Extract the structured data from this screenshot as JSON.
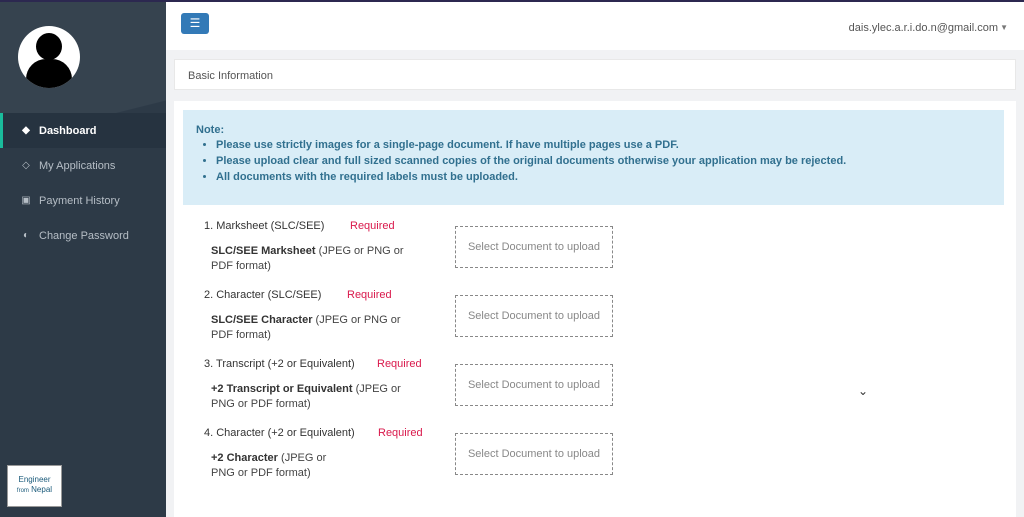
{
  "user": {
    "email": "dais.ylec.a.r.i.do.n@gmail.com"
  },
  "sidebar": {
    "items": [
      {
        "label": "Dashboard",
        "icon": "diamond-icon",
        "glyph": "◆",
        "active": true
      },
      {
        "label": "My Applications",
        "icon": "diamond-outline-icon",
        "glyph": "◇",
        "active": false
      },
      {
        "label": "Payment History",
        "icon": "money-icon",
        "glyph": "▣",
        "active": false
      },
      {
        "label": "Change Password",
        "icon": "toggle-icon",
        "glyph": "◐",
        "active": false
      }
    ],
    "logo_line1": "Engineer",
    "logo_line2": "from",
    "logo_line3": "Nepal"
  },
  "section_title": "Basic Information",
  "note": {
    "heading": "Note:",
    "items": [
      "Please use strictly images for a single-page document. If have multiple pages use a PDF.",
      "Please upload clear and full sized scanned copies of the original documents otherwise your application may be rejected.",
      "All documents with the required labels must be uploaded."
    ]
  },
  "documents": [
    {
      "title": "1. Marksheet (SLC/SEE)",
      "required": "Required",
      "desc_bold": "SLC/SEE Marksheet",
      "desc_rest": " (JPEG or PNG or PDF format)",
      "upload": "Select Document to upload"
    },
    {
      "title": "2. Character (SLC/SEE)",
      "required": "Required",
      "desc_bold": "SLC/SEE Character",
      "desc_rest": " (JPEG or PNG or PDF format)",
      "upload": "Select Document to upload"
    },
    {
      "title": "3. Transcript (+2 or Equivalent)",
      "required": "Required",
      "desc_bold": "+2 Transcript or Equivalent",
      "desc_rest": " (JPEG or PNG or PDF format)",
      "upload": "Select Document to upload"
    },
    {
      "title": "4. Character (+2 or Equivalent)",
      "required": "Required",
      "desc_bold": "+2 Character",
      "desc_rest": " (JPEG or PNG or PDF format)",
      "upload": "Select Document to upload"
    }
  ],
  "colors": {
    "sidebar": "#2d3a47",
    "accent": "#337ab7",
    "required": "#d9184b",
    "note_bg": "#d9edf7"
  }
}
